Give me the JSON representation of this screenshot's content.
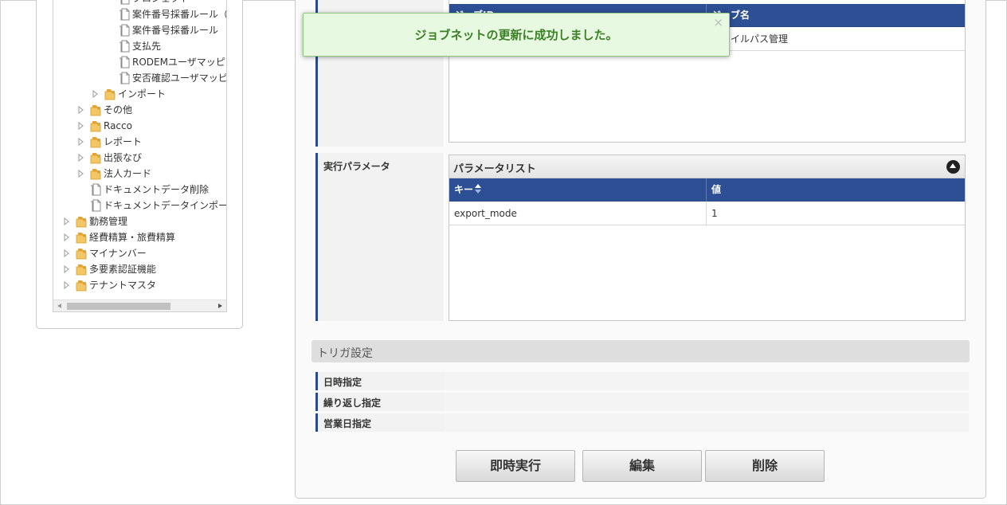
{
  "tree": {
    "items": [
      {
        "label": "プロジェクト",
        "type": "file",
        "level": 4
      },
      {
        "label": "案件番号採番ルール（",
        "type": "file",
        "level": 4
      },
      {
        "label": "案件番号採番ルール",
        "type": "file",
        "level": 4
      },
      {
        "label": "支払先",
        "type": "file",
        "level": 4
      },
      {
        "label": "RODEMユーザマッピ",
        "type": "file",
        "level": 4
      },
      {
        "label": "安否確認ユーザマッピ",
        "type": "file",
        "level": 4
      },
      {
        "label": "インポート",
        "type": "folder",
        "level": 3
      },
      {
        "label": "その他",
        "type": "folder",
        "level": 2
      },
      {
        "label": "Racco",
        "type": "folder",
        "level": 2
      },
      {
        "label": "レポート",
        "type": "folder",
        "level": 2
      },
      {
        "label": "出張なび",
        "type": "folder",
        "level": 2
      },
      {
        "label": "法人カード",
        "type": "folder",
        "level": 2
      },
      {
        "label": "ドキュメントデータ削除",
        "type": "file",
        "level": 2
      },
      {
        "label": "ドキュメントデータインポー",
        "type": "file",
        "level": 2
      },
      {
        "label": "勤務管理",
        "type": "folder",
        "level": 1
      },
      {
        "label": "経費精算・旅費精算",
        "type": "folder",
        "level": 1
      },
      {
        "label": "マイナンバー",
        "type": "folder",
        "level": 1
      },
      {
        "label": "多要素認証機能",
        "type": "folder",
        "level": 1
      },
      {
        "label": "テナントマスタ",
        "type": "folder",
        "level": 1
      }
    ]
  },
  "jobnet_grid": {
    "col1_header": "ジョブID",
    "col2_header": "ジョブ名",
    "row1_col2": "ファイルパス管理"
  },
  "params": {
    "row_label": "実行パラメータ",
    "caption": "パラメータリスト",
    "key_header": "キー",
    "value_header": "値",
    "rows": [
      {
        "key": "export_mode",
        "value": "1"
      }
    ]
  },
  "trigger": {
    "section_title": "トリガ設定",
    "rows": [
      {
        "label": "日時指定"
      },
      {
        "label": "繰り返し指定"
      },
      {
        "label": "営業日指定"
      }
    ]
  },
  "buttons": {
    "run_now": "即時実行",
    "edit": "編集",
    "delete": "削除"
  },
  "toast": {
    "message": "ジョブネットの更新に成功しました。",
    "close": "×"
  },
  "colors": {
    "accent_blue": "#2d4f94",
    "success_bg": "#e8f9e1",
    "success_text": "#3b7f26"
  }
}
